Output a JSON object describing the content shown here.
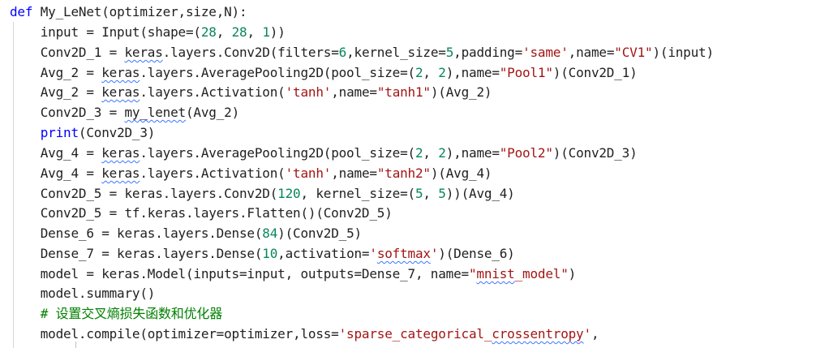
{
  "editor": {
    "lines": [
      [
        {
          "t": "def ",
          "c": "kwd"
        },
        {
          "t": "My_LeNet(optimizer,size,N):",
          "c": "fn"
        }
      ],
      [
        {
          "t": "    input = Input(shape=(",
          "c": "fn"
        },
        {
          "t": "28",
          "c": "num"
        },
        {
          "t": ", ",
          "c": "fn"
        },
        {
          "t": "28",
          "c": "num"
        },
        {
          "t": ", ",
          "c": "fn"
        },
        {
          "t": "1",
          "c": "num"
        },
        {
          "t": "))",
          "c": "fn"
        }
      ],
      [
        {
          "t": "    Conv2D_1 = ",
          "c": "fn"
        },
        {
          "t": "keras",
          "c": "fn",
          "s": 1
        },
        {
          "t": ".layers.Conv2D(filters=",
          "c": "fn"
        },
        {
          "t": "6",
          "c": "num"
        },
        {
          "t": ",kernel_size=",
          "c": "fn"
        },
        {
          "t": "5",
          "c": "num"
        },
        {
          "t": ",padding=",
          "c": "fn"
        },
        {
          "t": "'same'",
          "c": "str"
        },
        {
          "t": ",name=",
          "c": "fn"
        },
        {
          "t": "\"CV1\"",
          "c": "str"
        },
        {
          "t": ")(input)",
          "c": "fn"
        }
      ],
      [
        {
          "t": "    Avg_2 = ",
          "c": "fn"
        },
        {
          "t": "keras",
          "c": "fn",
          "s": 1
        },
        {
          "t": ".layers.AveragePooling2D(pool_size=(",
          "c": "fn"
        },
        {
          "t": "2",
          "c": "num"
        },
        {
          "t": ", ",
          "c": "fn"
        },
        {
          "t": "2",
          "c": "num"
        },
        {
          "t": "),name=",
          "c": "fn"
        },
        {
          "t": "\"Pool1\"",
          "c": "str"
        },
        {
          "t": ")(Conv2D_1)",
          "c": "fn"
        }
      ],
      [
        {
          "t": "    Avg_2 = ",
          "c": "fn"
        },
        {
          "t": "keras",
          "c": "fn",
          "s": 1
        },
        {
          "t": ".layers.Activation(",
          "c": "fn"
        },
        {
          "t": "'tanh'",
          "c": "str"
        },
        {
          "t": ",name=",
          "c": "fn"
        },
        {
          "t": "\"tanh1\"",
          "c": "str"
        },
        {
          "t": ")(Avg_2)",
          "c": "fn"
        }
      ],
      [
        {
          "t": "    Conv2D_3 = ",
          "c": "fn"
        },
        {
          "t": "my_lenet",
          "c": "fn",
          "s": 1
        },
        {
          "t": "(Avg_2)",
          "c": "fn"
        }
      ],
      [
        {
          "t": "    ",
          "c": "fn"
        },
        {
          "t": "print",
          "c": "kwd"
        },
        {
          "t": "(Conv2D_3)",
          "c": "fn"
        }
      ],
      [
        {
          "t": "    Avg_4 = ",
          "c": "fn"
        },
        {
          "t": "keras",
          "c": "fn",
          "s": 1
        },
        {
          "t": ".layers.AveragePooling2D(pool_size=(",
          "c": "fn"
        },
        {
          "t": "2",
          "c": "num"
        },
        {
          "t": ", ",
          "c": "fn"
        },
        {
          "t": "2",
          "c": "num"
        },
        {
          "t": "),name=",
          "c": "fn"
        },
        {
          "t": "\"Pool2\"",
          "c": "str"
        },
        {
          "t": ")(Conv2D_3)",
          "c": "fn"
        }
      ],
      [
        {
          "t": "    Avg_4 = ",
          "c": "fn"
        },
        {
          "t": "keras",
          "c": "fn",
          "s": 1
        },
        {
          "t": ".layers.Activation(",
          "c": "fn"
        },
        {
          "t": "'tanh'",
          "c": "str"
        },
        {
          "t": ",name=",
          "c": "fn"
        },
        {
          "t": "\"tanh2\"",
          "c": "str"
        },
        {
          "t": ")(Avg_4)",
          "c": "fn"
        }
      ],
      [
        {
          "t": "    Conv2D_5 = keras.layers.Conv2D(",
          "c": "fn"
        },
        {
          "t": "120",
          "c": "num"
        },
        {
          "t": ", kernel_size=(",
          "c": "fn"
        },
        {
          "t": "5",
          "c": "num"
        },
        {
          "t": ", ",
          "c": "fn"
        },
        {
          "t": "5",
          "c": "num"
        },
        {
          "t": "))(Avg_4)",
          "c": "fn"
        }
      ],
      [
        {
          "t": "    Conv2D_5 = tf.keras.layers.Flatten()(Conv2D_5)",
          "c": "fn"
        }
      ],
      [
        {
          "t": "    Dense_6 = keras.layers.Dense(",
          "c": "fn"
        },
        {
          "t": "84",
          "c": "num"
        },
        {
          "t": ")(Conv2D_5)",
          "c": "fn"
        }
      ],
      [
        {
          "t": "    Dense_7 = keras.layers.Dense(",
          "c": "fn"
        },
        {
          "t": "10",
          "c": "num"
        },
        {
          "t": ",activation=",
          "c": "fn"
        },
        {
          "t": "'",
          "c": "str"
        },
        {
          "t": "softmax",
          "c": "str",
          "s": 1
        },
        {
          "t": "'",
          "c": "str"
        },
        {
          "t": ")(Dense_6)",
          "c": "fn"
        }
      ],
      [
        {
          "t": "    model = keras.Model(inputs=input, outputs=Dense_7, name=",
          "c": "fn"
        },
        {
          "t": "\"",
          "c": "str"
        },
        {
          "t": "mnist",
          "c": "str",
          "s": 1
        },
        {
          "t": "_model\"",
          "c": "str"
        },
        {
          "t": ")",
          "c": "fn"
        }
      ],
      [
        {
          "t": "    model.summary()",
          "c": "fn"
        }
      ],
      [
        {
          "t": "    # 设置交叉熵损失函数和优化器",
          "c": "cm"
        }
      ],
      [
        {
          "t": "    model.compile(optimizer=optimizer,loss=",
          "c": "fn"
        },
        {
          "t": "'sparse_categorical_",
          "c": "str"
        },
        {
          "t": "crossentropy",
          "c": "str",
          "s": 1
        },
        {
          "t": "'",
          "c": "str"
        },
        {
          "t": ",",
          "c": "fn"
        }
      ]
    ]
  },
  "colors": {
    "keyword": "#0000ff",
    "string": "#a31515",
    "number": "#098658",
    "comment": "#008000",
    "text": "#212121",
    "squiggle": "#3b78ff"
  }
}
